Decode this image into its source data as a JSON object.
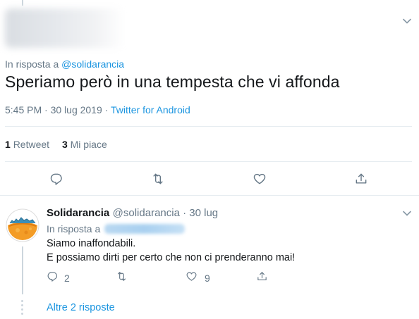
{
  "main_tweet": {
    "reply_prefix": "In risposta a",
    "reply_handle": "@solidarancia",
    "text": "Speriamo però in una tempesta che vi affonda",
    "timestamp": "5:45 PM · 30 lug 2019 · ",
    "source": "Twitter for Android",
    "stats": {
      "retweet_count": "1",
      "retweet_label": "Retweet",
      "like_count": "3",
      "like_label": "Mi piace"
    }
  },
  "reply_tweet": {
    "name": "Solidarancia",
    "handle_time": "@solidarancia · 30 lug",
    "reply_prefix": "In risposta a",
    "line1": "Siamo inaffondabili.",
    "line2": "E possiamo dirti per certo che non ci prenderanno mai!",
    "reply_count": "2",
    "like_count": "9"
  },
  "more_replies": "Altre 2 risposte",
  "colors": {
    "accent": "#1b95e0",
    "muted": "#657786",
    "text": "#14171a",
    "divider": "#e6ecf0"
  },
  "icons": [
    "chevron-down-icon",
    "reply-icon",
    "retweet-icon",
    "like-icon",
    "share-icon"
  ]
}
